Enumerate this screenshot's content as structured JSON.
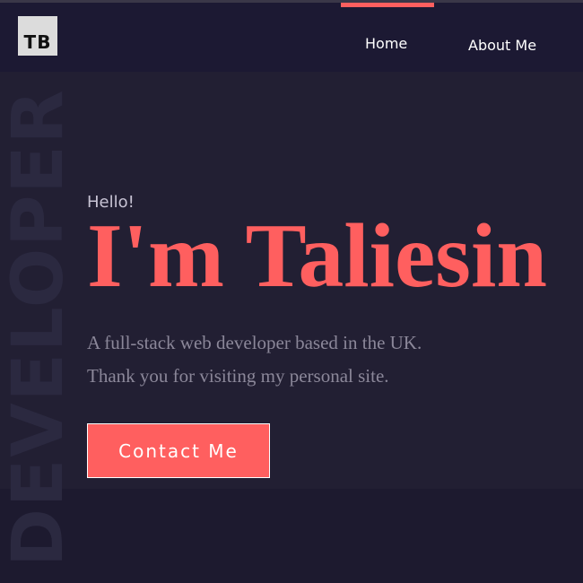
{
  "header": {
    "logo_text": "TB",
    "nav": [
      {
        "label": "Home",
        "active": true
      },
      {
        "label": "About Me",
        "active": false
      }
    ]
  },
  "hero": {
    "background_word": "DEVELOPER",
    "greeting": "Hello!",
    "headline": "I'm Taliesin",
    "tagline_lines": [
      "A full-stack web developer based in the UK.",
      "Thank you for visiting my personal site."
    ],
    "cta_label": "Contact Me"
  },
  "colors": {
    "accent": "#ff5f5f",
    "page_background": "#1d1a2f",
    "header_background": "#1c1933",
    "hero_panel_background": "#221f33",
    "muted_text": "#8b8799"
  }
}
